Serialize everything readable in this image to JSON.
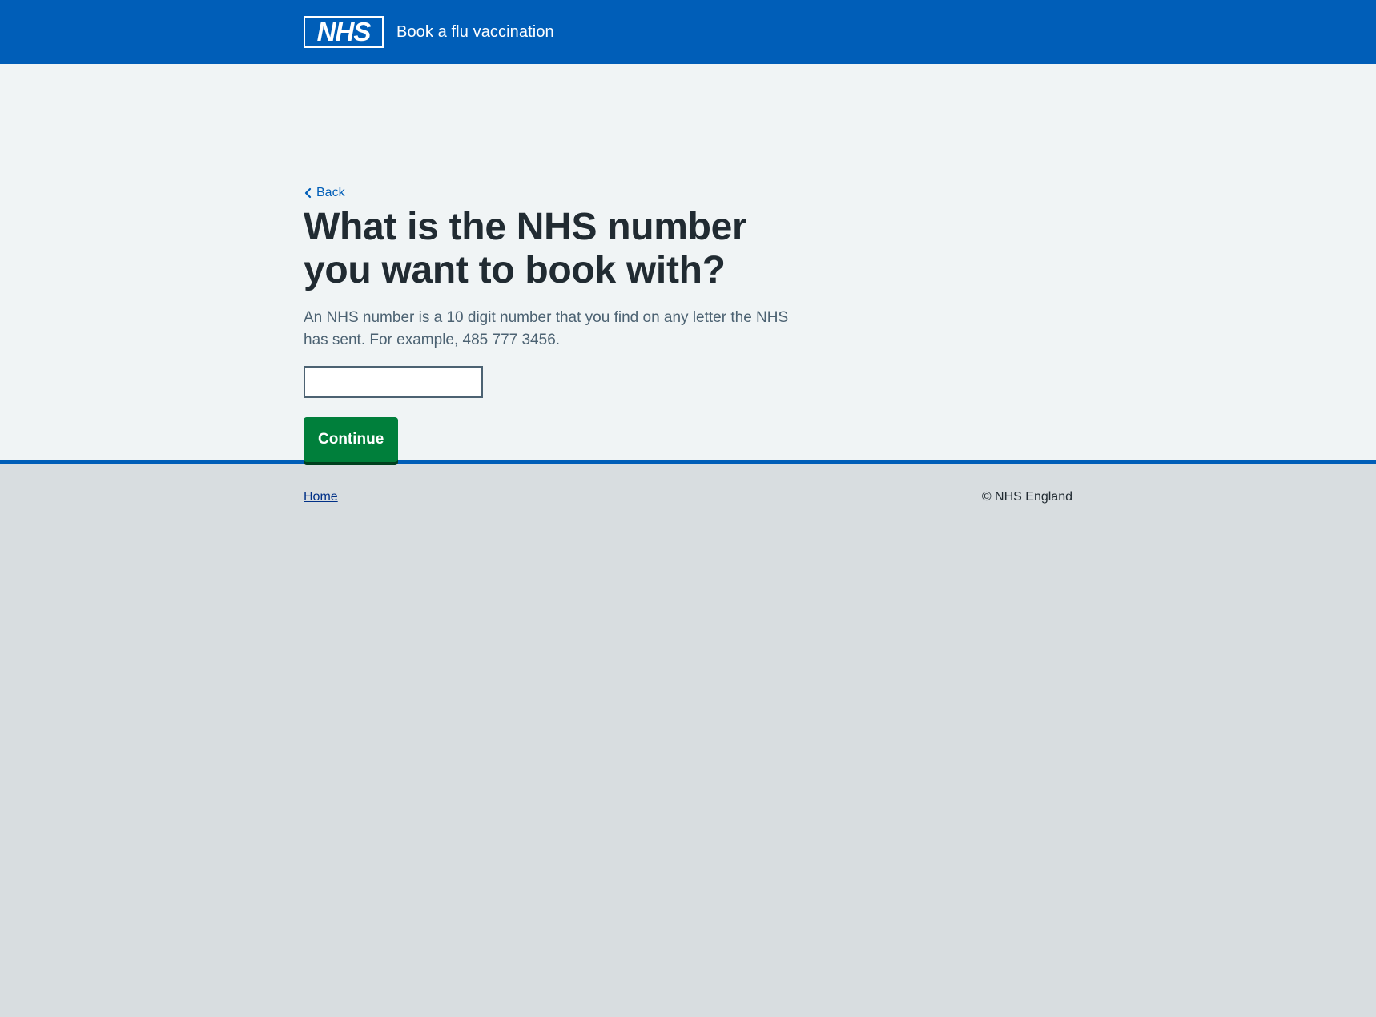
{
  "header": {
    "logo_text": "NHS",
    "service_name": "Book a flu vaccination"
  },
  "main": {
    "back_label": "Back",
    "heading": "What is the NHS number you want to book with?",
    "hint": "An NHS number is a 10 digit number that you find on any letter the NHS has sent. For example, 485 777 3456.",
    "input_value": "",
    "continue_label": "Continue"
  },
  "footer": {
    "home_label": "Home",
    "copyright": "© NHS England"
  },
  "colors": {
    "brand_blue": "#005eb8",
    "button_green": "#007f3b",
    "page_bg": "#f0f4f5",
    "footer_bg": "#d8dde0"
  },
  "icons": {
    "logo": "nhs-logo-icon",
    "back": "chevron-left-icon"
  }
}
